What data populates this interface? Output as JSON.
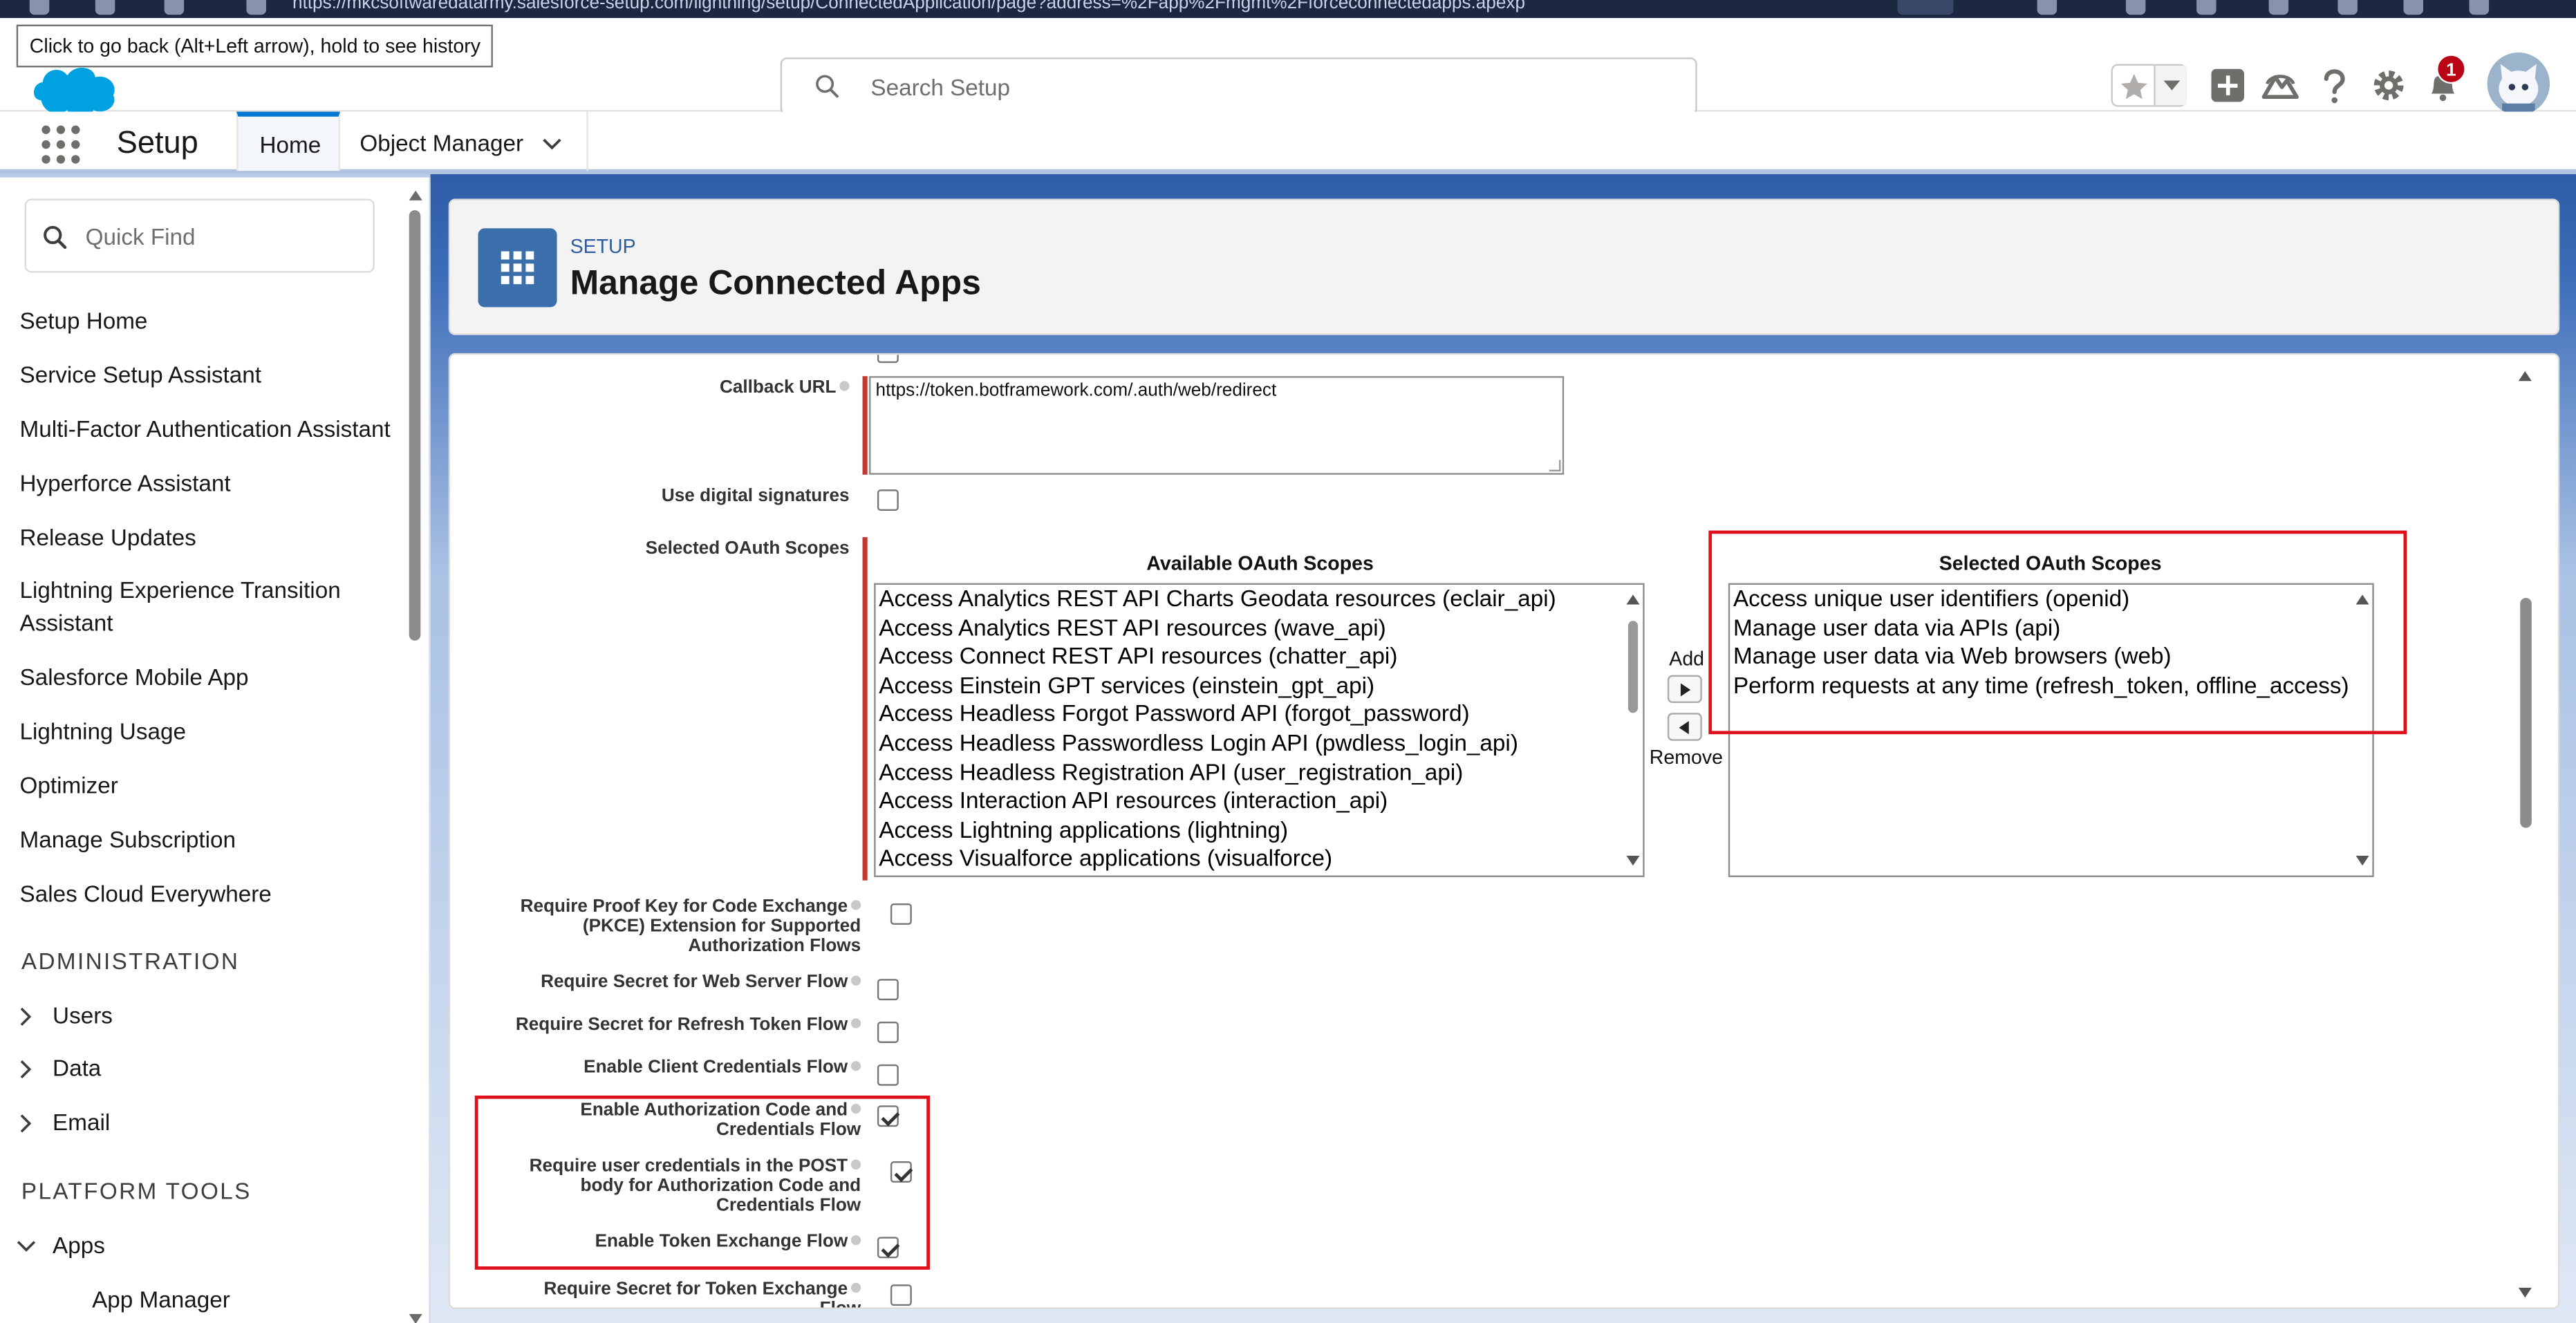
{
  "browser": {
    "url": "https://mkcsoftwaredatarmy.salesforce-setup.com/lightning/setup/ConnectedApplication/page?address=%2Fapp%2Fmgmt%2Fforceconnectedapps.apexp"
  },
  "tooltip": "Click to go back (Alt+Left arrow), hold to see history",
  "header": {
    "search_placeholder": "Search Setup",
    "notification_count": "1"
  },
  "context_bar": {
    "app_name": "Setup",
    "tabs": [
      {
        "label": "Home",
        "active": true
      },
      {
        "label": "Object Manager",
        "active": false
      }
    ]
  },
  "sidebar": {
    "quick_find_placeholder": "Quick Find",
    "items": [
      {
        "label": "Setup Home"
      },
      {
        "label": "Service Setup Assistant"
      },
      {
        "label": "Multi-Factor Authentication Assistant"
      },
      {
        "label": "Hyperforce Assistant"
      },
      {
        "label": "Release Updates"
      },
      {
        "label": "Lightning Experience Transition Assistant"
      },
      {
        "label": "Salesforce Mobile App"
      },
      {
        "label": "Lightning Usage"
      },
      {
        "label": "Optimizer"
      },
      {
        "label": "Manage Subscription"
      },
      {
        "label": "Sales Cloud Everywhere"
      }
    ],
    "section_admin": "ADMINISTRATION",
    "admin_items": [
      {
        "label": "Users",
        "expanded": false
      },
      {
        "label": "Data",
        "expanded": false
      },
      {
        "label": "Email",
        "expanded": false
      }
    ],
    "section_platform": "PLATFORM TOOLS",
    "platform_items": [
      {
        "label": "Apps",
        "expanded": true
      }
    ],
    "apps_sub_items": [
      {
        "label": "App Manager"
      }
    ]
  },
  "page_header": {
    "kicker": "SETUP",
    "title": "Manage Connected Apps"
  },
  "form": {
    "callback_url": {
      "label": "Callback URL",
      "value": "https://token.botframework.com/.auth/web/redirect"
    },
    "use_digital_signatures": {
      "label": "Use digital signatures",
      "checked": false
    },
    "selected_oauth_scopes_label": "Selected OAuth Scopes",
    "available_title": "Available OAuth Scopes",
    "selected_title": "Selected OAuth Scopes",
    "available_scopes": [
      "Access Analytics REST API Charts Geodata resources (eclair_api)",
      "Access Analytics REST API resources (wave_api)",
      "Access Connect REST API resources (chatter_api)",
      "Access Einstein GPT services (einstein_gpt_api)",
      "Access Headless Forgot Password API (forgot_password)",
      "Access Headless Passwordless Login API (pwdless_login_api)",
      "Access Headless Registration API (user_registration_api)",
      "Access Interaction API resources (interaction_api)",
      "Access Lightning applications (lightning)",
      "Access Visualforce applications (visualforce)"
    ],
    "selected_scopes": [
      "Access unique user identifiers (openid)",
      "Manage user data via APIs (api)",
      "Manage user data via Web browsers (web)",
      "Perform requests at any time (refresh_token, offline_access)"
    ],
    "add_label": "Add",
    "remove_label": "Remove",
    "checkbox_fields": [
      {
        "label": "Require Proof Key for Code Exchange (PKCE) Extension for Supported Authorization Flows",
        "lines": [
          "Require Proof Key for Code Exchange",
          "(PKCE) Extension for Supported",
          "Authorization Flows"
        ],
        "checked": false
      },
      {
        "label": "Require Secret for Web Server Flow",
        "lines": [
          "Require Secret for Web Server Flow"
        ],
        "checked": false
      },
      {
        "label": "Require Secret for Refresh Token Flow",
        "lines": [
          "Require Secret for Refresh Token Flow"
        ],
        "checked": false
      },
      {
        "label": "Enable Client Credentials Flow",
        "lines": [
          "Enable Client Credentials Flow"
        ],
        "checked": false
      },
      {
        "label": "Enable Authorization Code and Credentials Flow",
        "lines": [
          "Enable Authorization Code and",
          "Credentials Flow"
        ],
        "checked": true
      },
      {
        "label": "Require user credentials in the POST body for Authorization Code and Credentials Flow",
        "lines": [
          "Require user credentials in the POST",
          "body for Authorization Code and",
          "Credentials Flow"
        ],
        "checked": true
      },
      {
        "label": "Enable Token Exchange Flow",
        "lines": [
          "Enable Token Exchange Flow"
        ],
        "checked": true
      },
      {
        "label": "Require Secret for Token Exchange Flow",
        "lines": [
          "Require Secret for Token Exchange",
          "Flow"
        ],
        "checked": false
      }
    ]
  },
  "colors": {
    "brand_blue": "#0176d3",
    "highlight_red": "#e0101a",
    "required_bar": "#c23934",
    "notification_red": "#ba0517"
  }
}
